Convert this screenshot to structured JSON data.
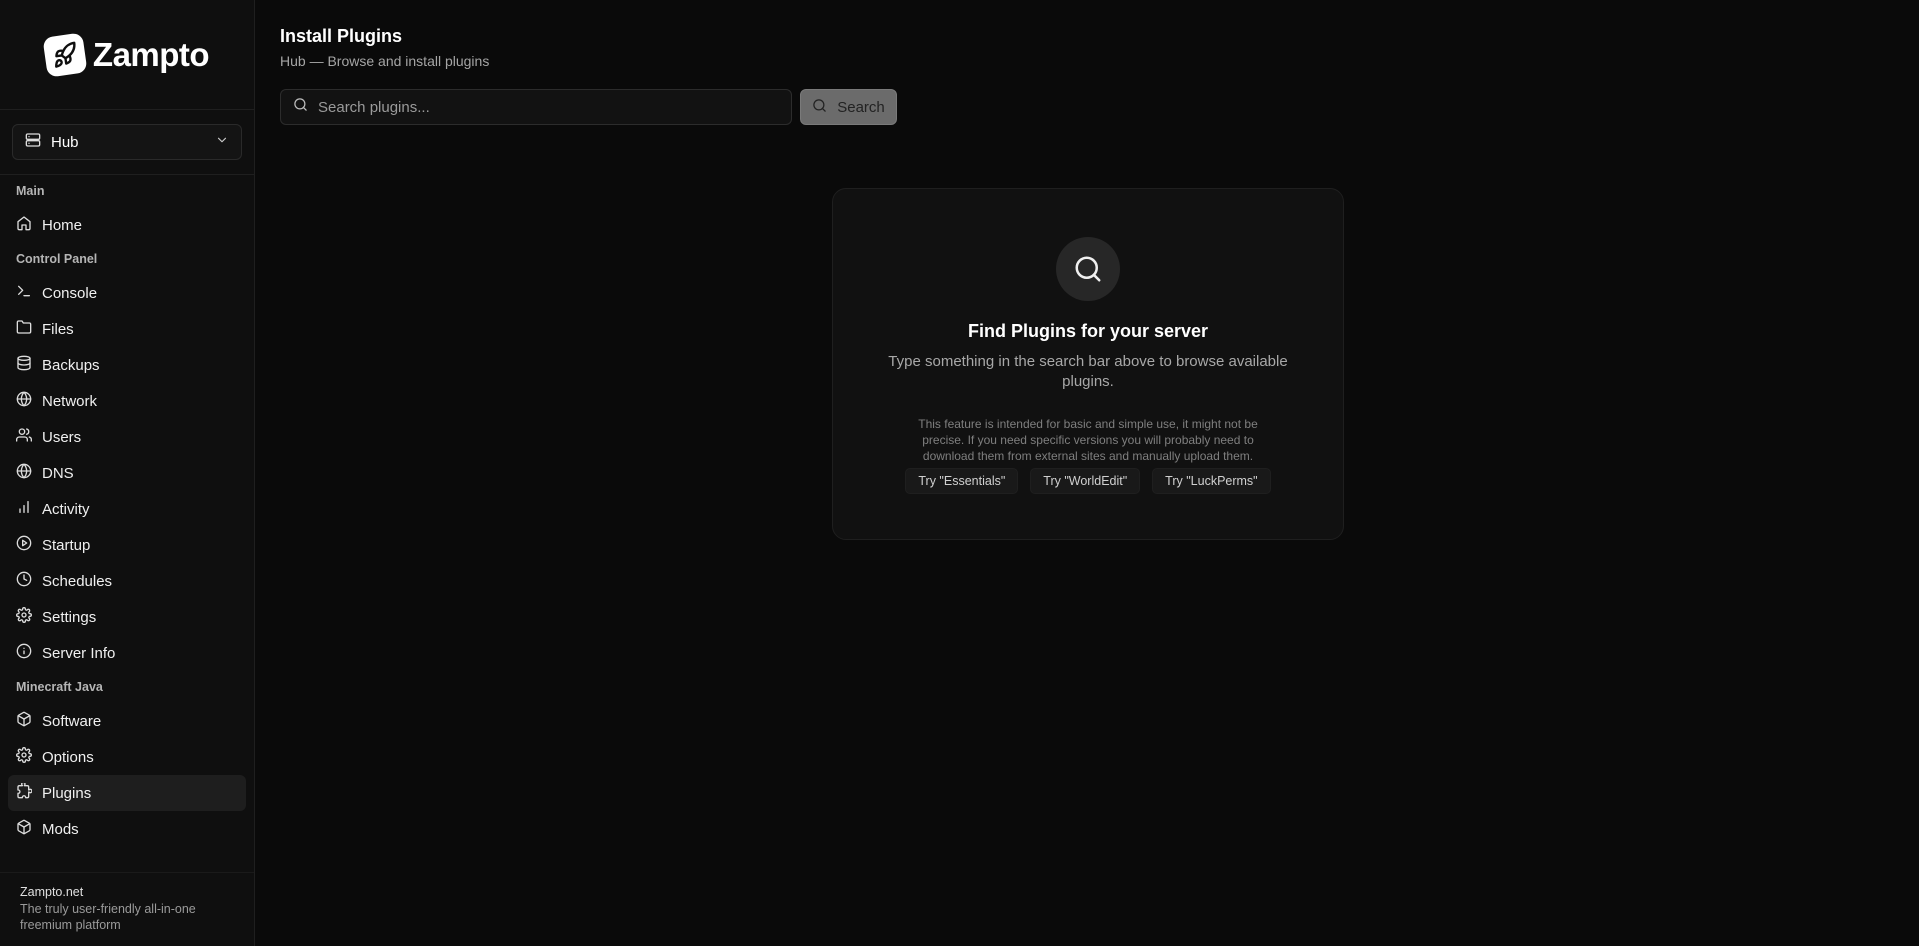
{
  "brand": {
    "name": "Zampto",
    "icon": "rocket-icon"
  },
  "server_select": {
    "label": "Hub",
    "icon": "server-icon"
  },
  "sidebar": {
    "sections": [
      {
        "title": "Main",
        "items": [
          {
            "label": "Home",
            "icon": "home-icon"
          }
        ]
      },
      {
        "title": "Control Panel",
        "items": [
          {
            "label": "Console",
            "icon": "terminal-icon"
          },
          {
            "label": "Files",
            "icon": "folder-icon"
          },
          {
            "label": "Backups",
            "icon": "database-icon"
          },
          {
            "label": "Network",
            "icon": "globe-icon"
          },
          {
            "label": "Users",
            "icon": "users-icon"
          },
          {
            "label": "DNS",
            "icon": "globe-icon"
          },
          {
            "label": "Activity",
            "icon": "bar-chart-icon"
          },
          {
            "label": "Startup",
            "icon": "play-circle-icon"
          },
          {
            "label": "Schedules",
            "icon": "clock-icon"
          },
          {
            "label": "Settings",
            "icon": "gear-icon"
          },
          {
            "label": "Server Info",
            "icon": "info-icon"
          }
        ]
      },
      {
        "title": "Minecraft Java",
        "items": [
          {
            "label": "Software",
            "icon": "cube-icon"
          },
          {
            "label": "Options",
            "icon": "gear-icon"
          },
          {
            "label": "Plugins",
            "icon": "puzzle-icon",
            "active": true
          },
          {
            "label": "Mods",
            "icon": "cube-icon"
          }
        ]
      }
    ],
    "footer": {
      "title": "Zampto.net",
      "subtitle": "The truly user-friendly all-in-one freemium platform"
    }
  },
  "header": {
    "title": "Install Plugins",
    "subtitle": "Hub — Browse and install plugins"
  },
  "search": {
    "placeholder": "Search plugins...",
    "value": "",
    "button_label": "Search"
  },
  "empty_state": {
    "icon": "search-icon",
    "title": "Find Plugins for your server",
    "description": "Type something in the search bar above to browse available plugins.",
    "note": "This feature is intended for basic and simple use, it might not be precise. If you need specific versions you will probably need to download them from external sites and manually upload them.",
    "suggestions": [
      "Try \"Essentials\"",
      "Try \"WorldEdit\"",
      "Try \"LuckPerms\""
    ]
  },
  "colors": {
    "background": "#0a0a0a",
    "sidebar": "#0f0f0f",
    "active_item": "#1e1e1e",
    "search_button": "#6b6b6b"
  }
}
